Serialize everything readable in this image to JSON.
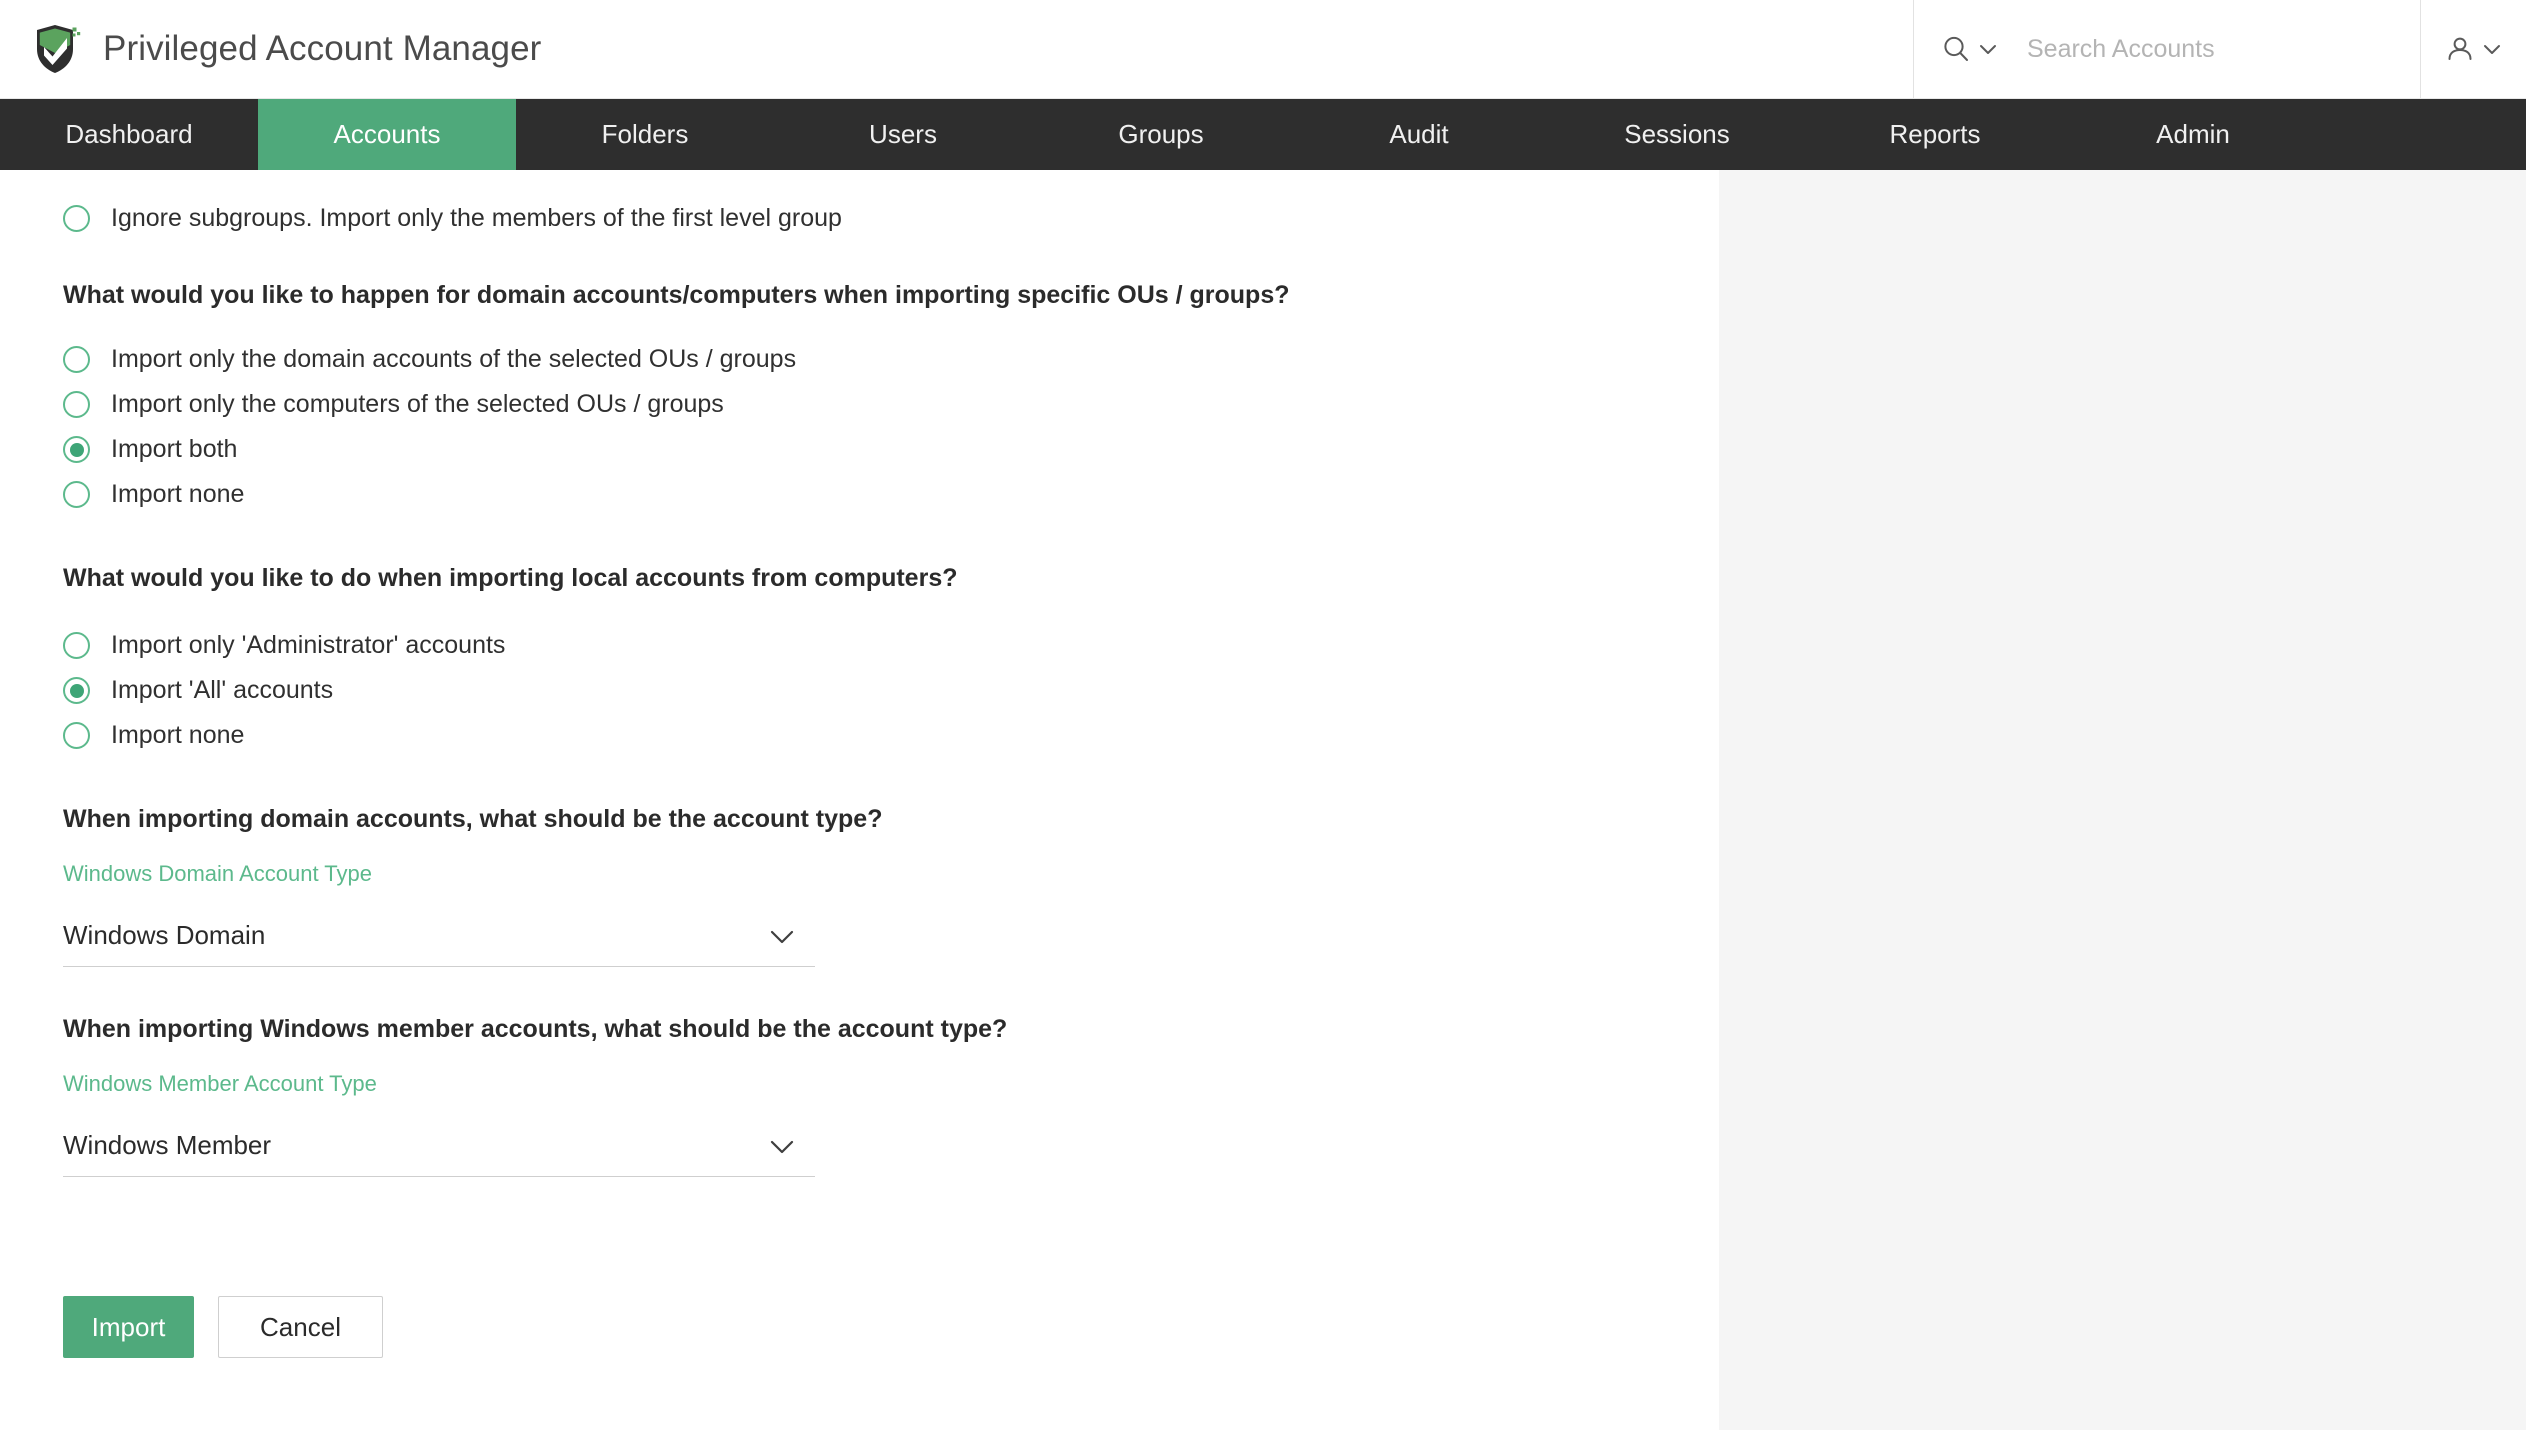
{
  "header": {
    "app_title": "Privileged Account Manager",
    "logo_icon": "shield-check-icon",
    "search": {
      "icon": "search-icon",
      "dropdown_icon": "chevron-down-icon",
      "placeholder": "Search Accounts",
      "value": ""
    },
    "user_menu": {
      "icon": "user-icon",
      "dropdown_icon": "chevron-down-icon"
    }
  },
  "nav": {
    "active": "Accounts",
    "tabs": [
      {
        "label": "Dashboard"
      },
      {
        "label": "Accounts"
      },
      {
        "label": "Folders"
      },
      {
        "label": "Users"
      },
      {
        "label": "Groups"
      },
      {
        "label": "Audit"
      },
      {
        "label": "Sessions"
      },
      {
        "label": "Reports"
      },
      {
        "label": "Admin"
      }
    ]
  },
  "form": {
    "subgroup_option": {
      "label": "Ignore subgroups. Import only the members of the first level group",
      "checked": false
    },
    "question_domain": "What would you like to happen for domain accounts/computers when importing specific OUs / groups?",
    "domain_options": [
      {
        "label": "Import only the domain accounts of the selected OUs / groups",
        "checked": false
      },
      {
        "label": "Import only the computers of the selected OUs / groups",
        "checked": false
      },
      {
        "label": "Import both",
        "checked": true
      },
      {
        "label": "Import none",
        "checked": false
      }
    ],
    "question_local": "What would you like to do when importing local accounts from computers?",
    "local_options": [
      {
        "label": "Import only 'Administrator' accounts",
        "checked": false
      },
      {
        "label": "Import 'All' accounts",
        "checked": true
      },
      {
        "label": "Import none",
        "checked": false
      }
    ],
    "question_domain_type": "When importing domain accounts, what should be the account type?",
    "domain_type_select": {
      "caption": "Windows Domain Account Type",
      "value": "Windows Domain",
      "icon": "chevron-down-icon"
    },
    "question_member_type": "When importing Windows member accounts, what should be the account type?",
    "member_type_select": {
      "caption": "Windows Member Account Type",
      "value": "Windows Member",
      "icon": "chevron-down-icon"
    },
    "import_button": "Import",
    "cancel_button": "Cancel"
  },
  "colors": {
    "accent_green": "#4fa97b",
    "radio_green": "#5cb98c",
    "nav_dark": "#2e2e2e",
    "side_panel": "#f5f5f5"
  }
}
